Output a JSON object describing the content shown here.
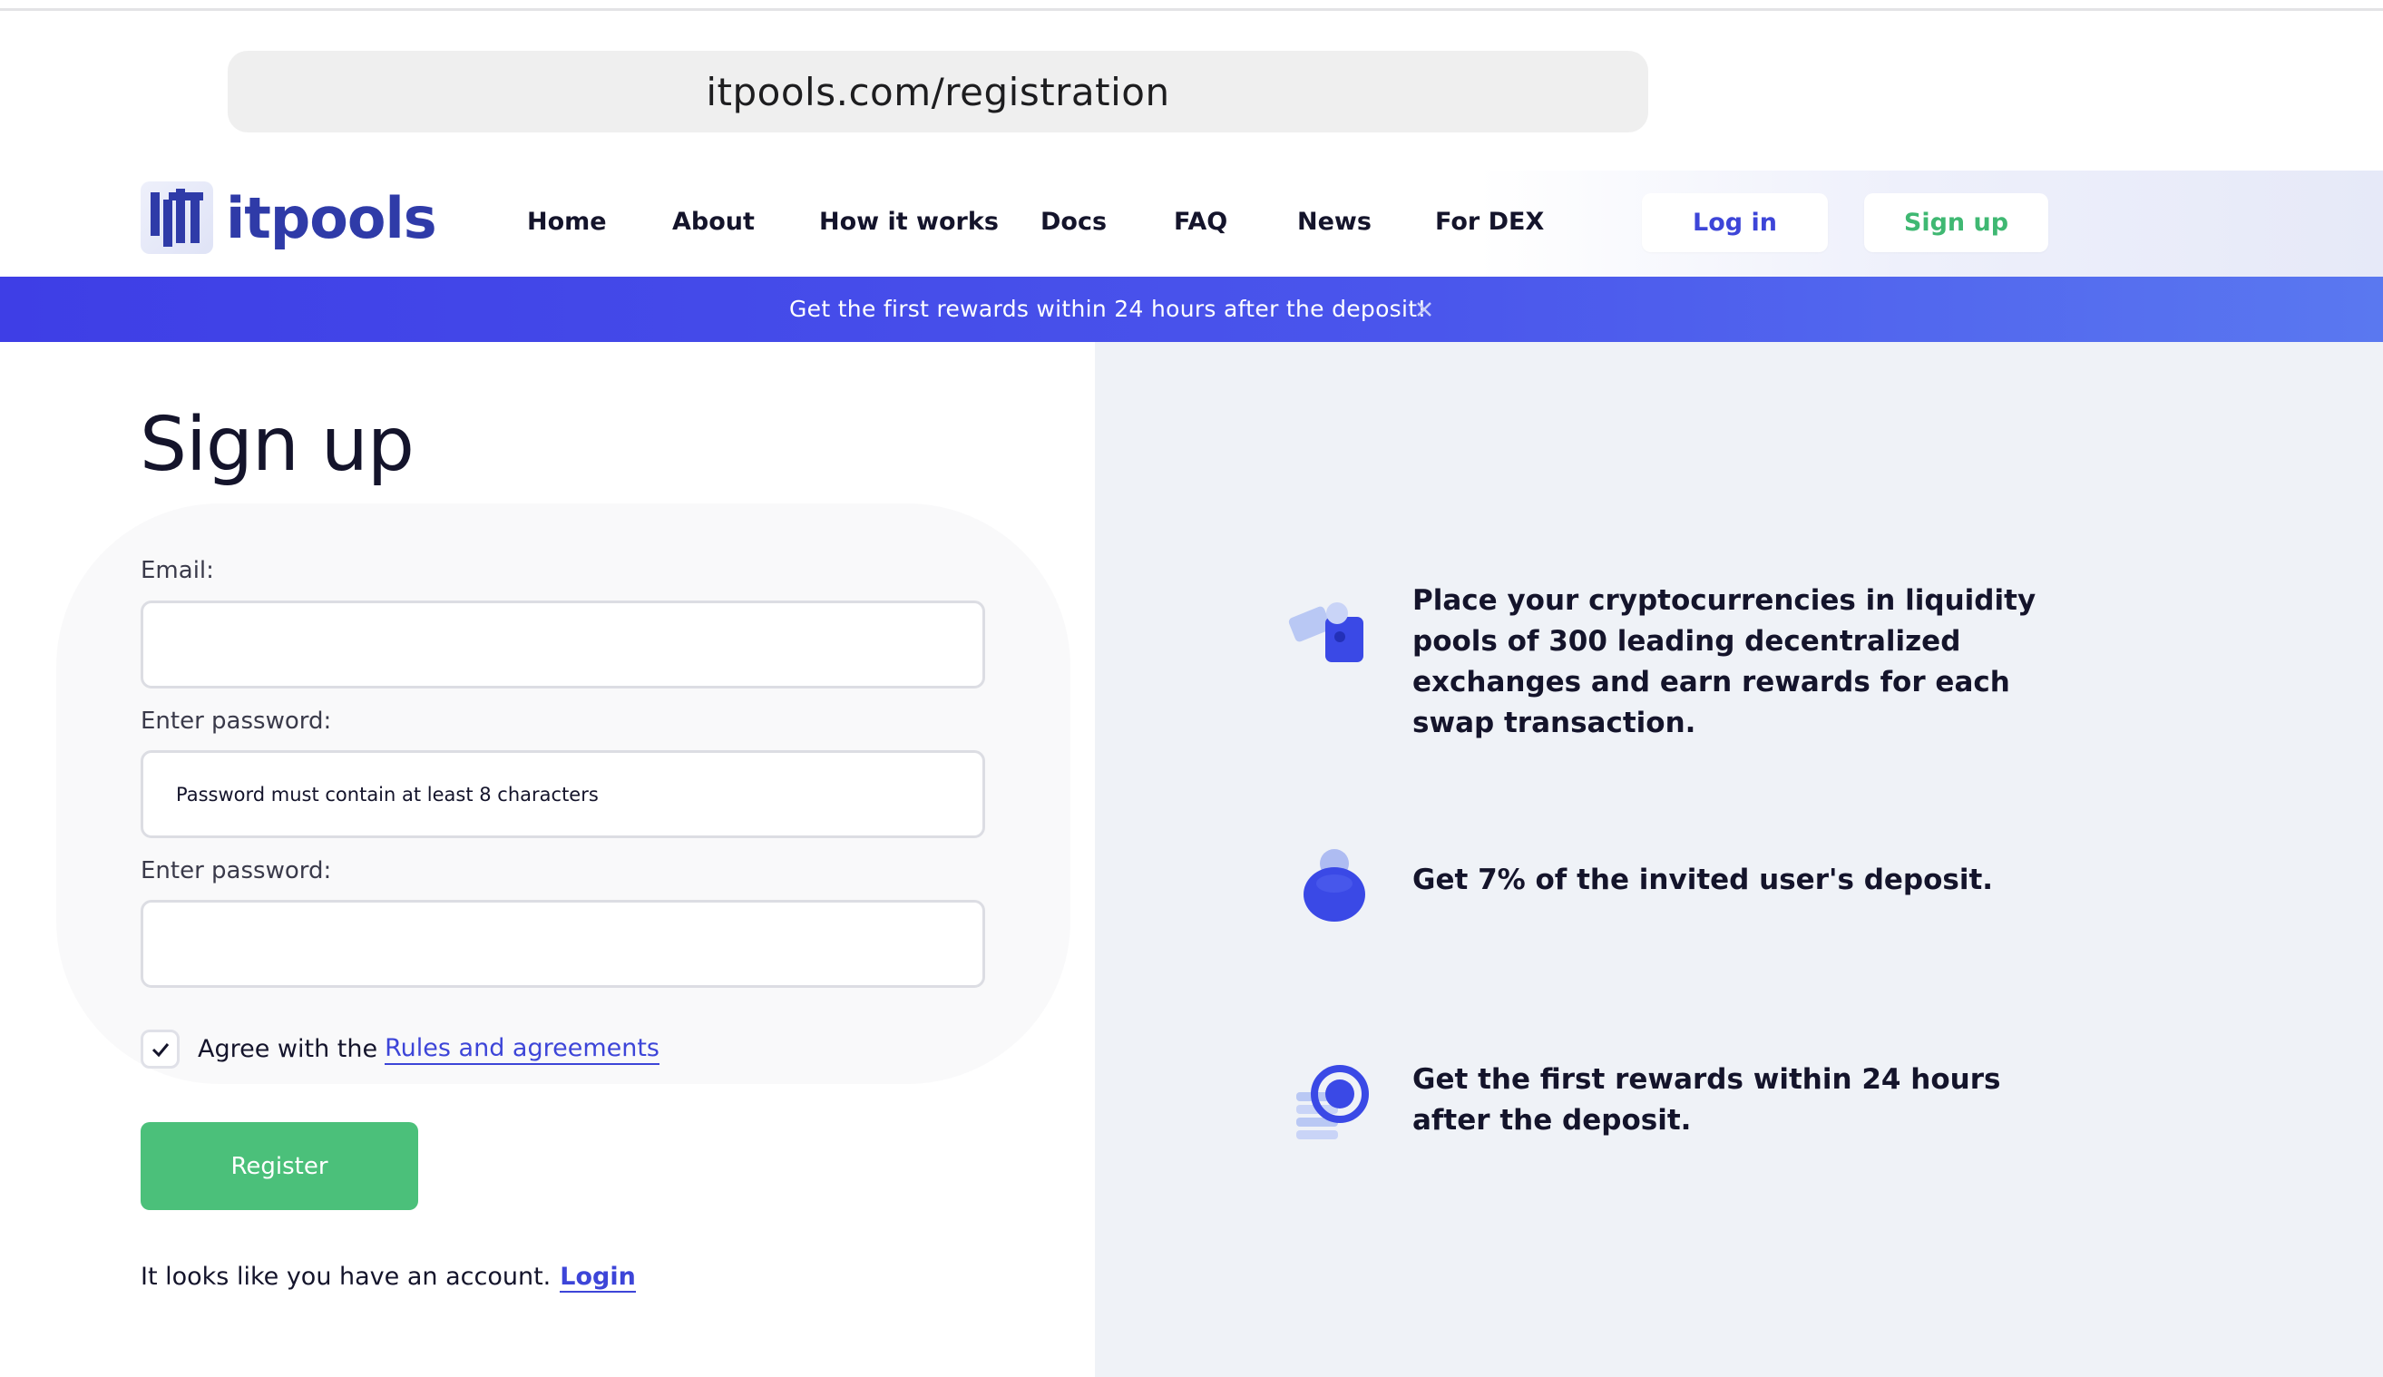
{
  "browser": {
    "url": "itpools.com/registration"
  },
  "header": {
    "logo_text": "itpools",
    "nav": [
      {
        "label": "Home"
      },
      {
        "label": "About"
      },
      {
        "label": "How it works"
      },
      {
        "label": "Docs"
      },
      {
        "label": "FAQ"
      },
      {
        "label": "News"
      },
      {
        "label": "For DEX"
      }
    ],
    "login_label": "Log in",
    "signup_label": "Sign up"
  },
  "banner": {
    "text": "Get the first rewards within 24 hours after the deposit!"
  },
  "form": {
    "title": "Sign up",
    "email_label": "Email:",
    "email_value": "",
    "password_label": "Enter password:",
    "password_placeholder": "Password must contain at least 8 characters",
    "confirm_label": "Enter password:",
    "confirm_value": "",
    "agree_text": "Agree with the",
    "agree_link": "Rules and agreements",
    "agree_checked": true,
    "register_label": "Register",
    "account_text": "It looks like you have an account.",
    "login_link": "Login"
  },
  "features": [
    {
      "icon": "liquidity-pool-icon",
      "text": "Place your cryptocurrencies in liquidity pools of 300 leading decentralized exchanges and earn rewards for each swap transaction."
    },
    {
      "icon": "user-invite-icon",
      "text": "Get 7% of the invited user's deposit."
    },
    {
      "icon": "coins-clock-icon",
      "text": "Get the first rewards within 24 hours after the deposit."
    }
  ],
  "colors": {
    "accent": "#3d45d8",
    "banner": "#4a56ec",
    "register": "#4bc07a",
    "signup_text": "#3fb872",
    "right_panel": "#eff2f7"
  }
}
